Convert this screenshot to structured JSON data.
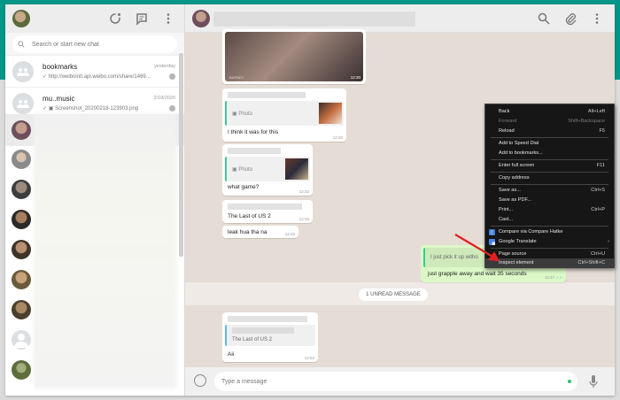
{
  "left_panel": {
    "search_placeholder": "Search or start new chat",
    "chats": [
      {
        "name": "bookmarks",
        "time": "yesterday",
        "preview": "✓ http://weibointl.api.weibo.com/share/1469..."
      },
      {
        "name": "mu..music",
        "time": "2/18/2020",
        "preview": "✓ ▣ Screenshot_20200218-123903.png"
      }
    ]
  },
  "conversation": {
    "messages": [
      {
        "text": "BARNEY",
        "time": "12:30"
      },
      {
        "quote_label": "Photo",
        "text": "I think it was for this",
        "time": "12:30"
      },
      {
        "quote_label": "Photo",
        "text": "what game?",
        "time": "12:32"
      },
      {
        "text": "The Last of US 2",
        "time": "12:33"
      },
      {
        "text": "leak hua tha na",
        "time": "12:33"
      },
      {
        "text": "I just pick it up witho",
        "time": ""
      },
      {
        "text": "just grapple away and wait 35 seconds",
        "time": "12:47"
      },
      {
        "quote_text": "The Last of US 2",
        "text": "Aii",
        "time": "12:53"
      }
    ],
    "unread_label": "1 UNREAD MESSAGE",
    "composer_placeholder": "Type a message"
  },
  "context_menu": {
    "items": [
      {
        "label": "Back",
        "shortcut": "Alt+Left"
      },
      {
        "label": "Forward",
        "shortcut": "Shift+Backspace"
      },
      {
        "label": "Reload",
        "shortcut": "F5"
      },
      {
        "label": "Add to Speed Dial",
        "shortcut": ""
      },
      {
        "label": "Add to bookmarks...",
        "shortcut": ""
      },
      {
        "label": "Enter full screen",
        "shortcut": "F11"
      },
      {
        "label": "Copy address",
        "shortcut": ""
      },
      {
        "label": "Save as...",
        "shortcut": "Ctrl+S"
      },
      {
        "label": "Save as PDF...",
        "shortcut": ""
      },
      {
        "label": "Print...",
        "shortcut": "Ctrl+P"
      },
      {
        "label": "Cast...",
        "shortcut": ""
      },
      {
        "label": "Compare via Compare Hatke",
        "shortcut": ""
      },
      {
        "label": "Google Translate",
        "shortcut": ""
      },
      {
        "label": "Page source",
        "shortcut": "Ctrl+U"
      },
      {
        "label": "Inspect element",
        "shortcut": "Ctrl+Shift+C"
      }
    ]
  },
  "colors": {
    "header_band": "#009688",
    "chat_background": "#e5ddd5",
    "outgoing_bubble": "#dcf8c6",
    "menu_background": "#161616",
    "annotation_arrow": "#e02020"
  }
}
